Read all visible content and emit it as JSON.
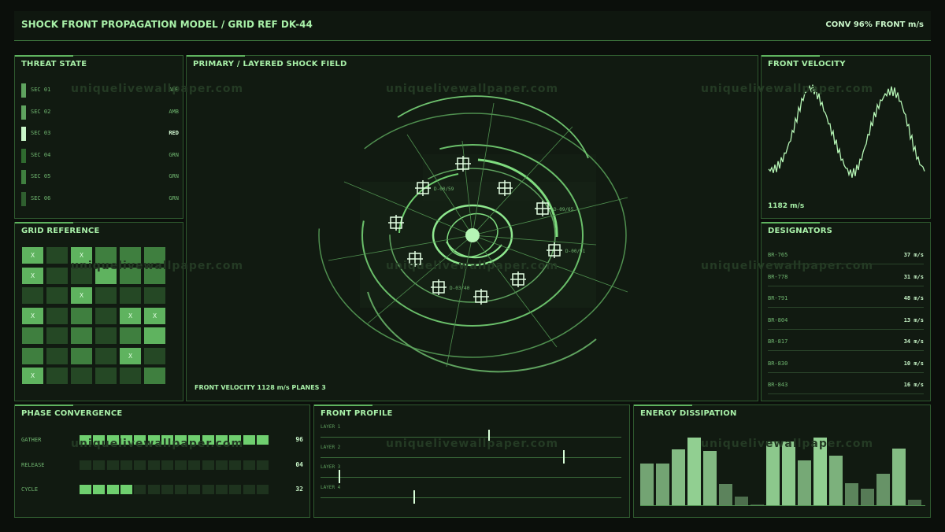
{
  "header": {
    "title": "SHOCK FRONT PROPAGATION MODEL / GRID REF DK-44",
    "status": "CONV 96%  FRONT m/s"
  },
  "watermark": "uniquelivewallpaper.com",
  "threat": {
    "title": "THREAT STATE",
    "rows": [
      {
        "label": "SEC 01",
        "value": "AMB",
        "color": "#5fa35f"
      },
      {
        "label": "SEC 02",
        "value": "AMB",
        "color": "#5fa35f"
      },
      {
        "label": "SEC 03",
        "value": "RED",
        "color": "#c8f5c8"
      },
      {
        "label": "SEC 04",
        "value": "GRN",
        "color": "#2f6a2f"
      },
      {
        "label": "SEC 05",
        "value": "GRN",
        "color": "#3f7f3f"
      },
      {
        "label": "SEC 06",
        "value": "GRN",
        "color": "#2f5f2f"
      }
    ]
  },
  "grid": {
    "title": "GRID REFERENCE",
    "marker": "X",
    "cells": [
      [
        1,
        0,
        1,
        0,
        0,
        0
      ],
      [
        1,
        0,
        0,
        0,
        0,
        0
      ],
      [
        0,
        0,
        1,
        0,
        0,
        0
      ],
      [
        1,
        0,
        0,
        0,
        1,
        1
      ],
      [
        0,
        0,
        0,
        0,
        0,
        0
      ],
      [
        0,
        0,
        0,
        0,
        1,
        0
      ],
      [
        1,
        0,
        0,
        0,
        0,
        0
      ]
    ],
    "shades": [
      [
        3,
        1,
        3,
        2,
        2,
        2
      ],
      [
        3,
        1,
        1,
        3,
        2,
        2
      ],
      [
        1,
        1,
        3,
        1,
        1,
        1
      ],
      [
        3,
        1,
        2,
        1,
        3,
        3
      ],
      [
        2,
        1,
        2,
        1,
        2,
        3
      ],
      [
        2,
        1,
        2,
        1,
        3,
        1
      ],
      [
        3,
        1,
        1,
        1,
        1,
        2
      ]
    ]
  },
  "primary": {
    "title": "PRIMARY / LAYERED SHOCK FIELD",
    "footer": "FRONT VELOCITY 1128 m/s   PLANES 3",
    "targets": [
      {
        "label": "D-00/59"
      },
      {
        "label": "D-09/65"
      },
      {
        "label": "D-00/91"
      },
      {
        "label": "D-03/40"
      }
    ]
  },
  "velocity": {
    "title": "FRONT VELOCITY",
    "readout": "1182 m/s"
  },
  "designators": {
    "title": "DESIGNATORS",
    "rows": [
      {
        "id": "BR-765",
        "value": "37 m/s"
      },
      {
        "id": "BR-778",
        "value": "31 m/s"
      },
      {
        "id": "BR-791",
        "value": "48 m/s"
      },
      {
        "id": "BR-804",
        "value": "13 m/s"
      },
      {
        "id": "BR-817",
        "value": "34 m/s"
      },
      {
        "id": "BR-830",
        "value": "10 m/s"
      },
      {
        "id": "BR-843",
        "value": "16 m/s"
      }
    ]
  },
  "phase": {
    "title": "PHASE CONVERGENCE",
    "segments_total": 14,
    "rows": [
      {
        "label": "GATHER",
        "value": "96",
        "filled": 14
      },
      {
        "label": "RELEASE",
        "value": "04",
        "filled": 0
      },
      {
        "label": "CYCLE",
        "value": "32",
        "filled": 4
      }
    ]
  },
  "profile": {
    "title": "FRONT PROFILE",
    "layers": [
      {
        "label": "LAYER 1",
        "position": 0.56
      },
      {
        "label": "LAYER 2",
        "position": 0.81
      },
      {
        "label": "LAYER 3",
        "position": 0.06
      },
      {
        "label": "LAYER 4",
        "position": 0.31
      }
    ]
  },
  "energy": {
    "title": "ENERGY DISSIPATION",
    "values": [
      0.62,
      0.62,
      0.83,
      1.0,
      0.8,
      0.32,
      0.13,
      0.0,
      0.94,
      0.94,
      0.66,
      1.0,
      0.73,
      0.33,
      0.25,
      0.46,
      0.84,
      0.08
    ]
  }
}
